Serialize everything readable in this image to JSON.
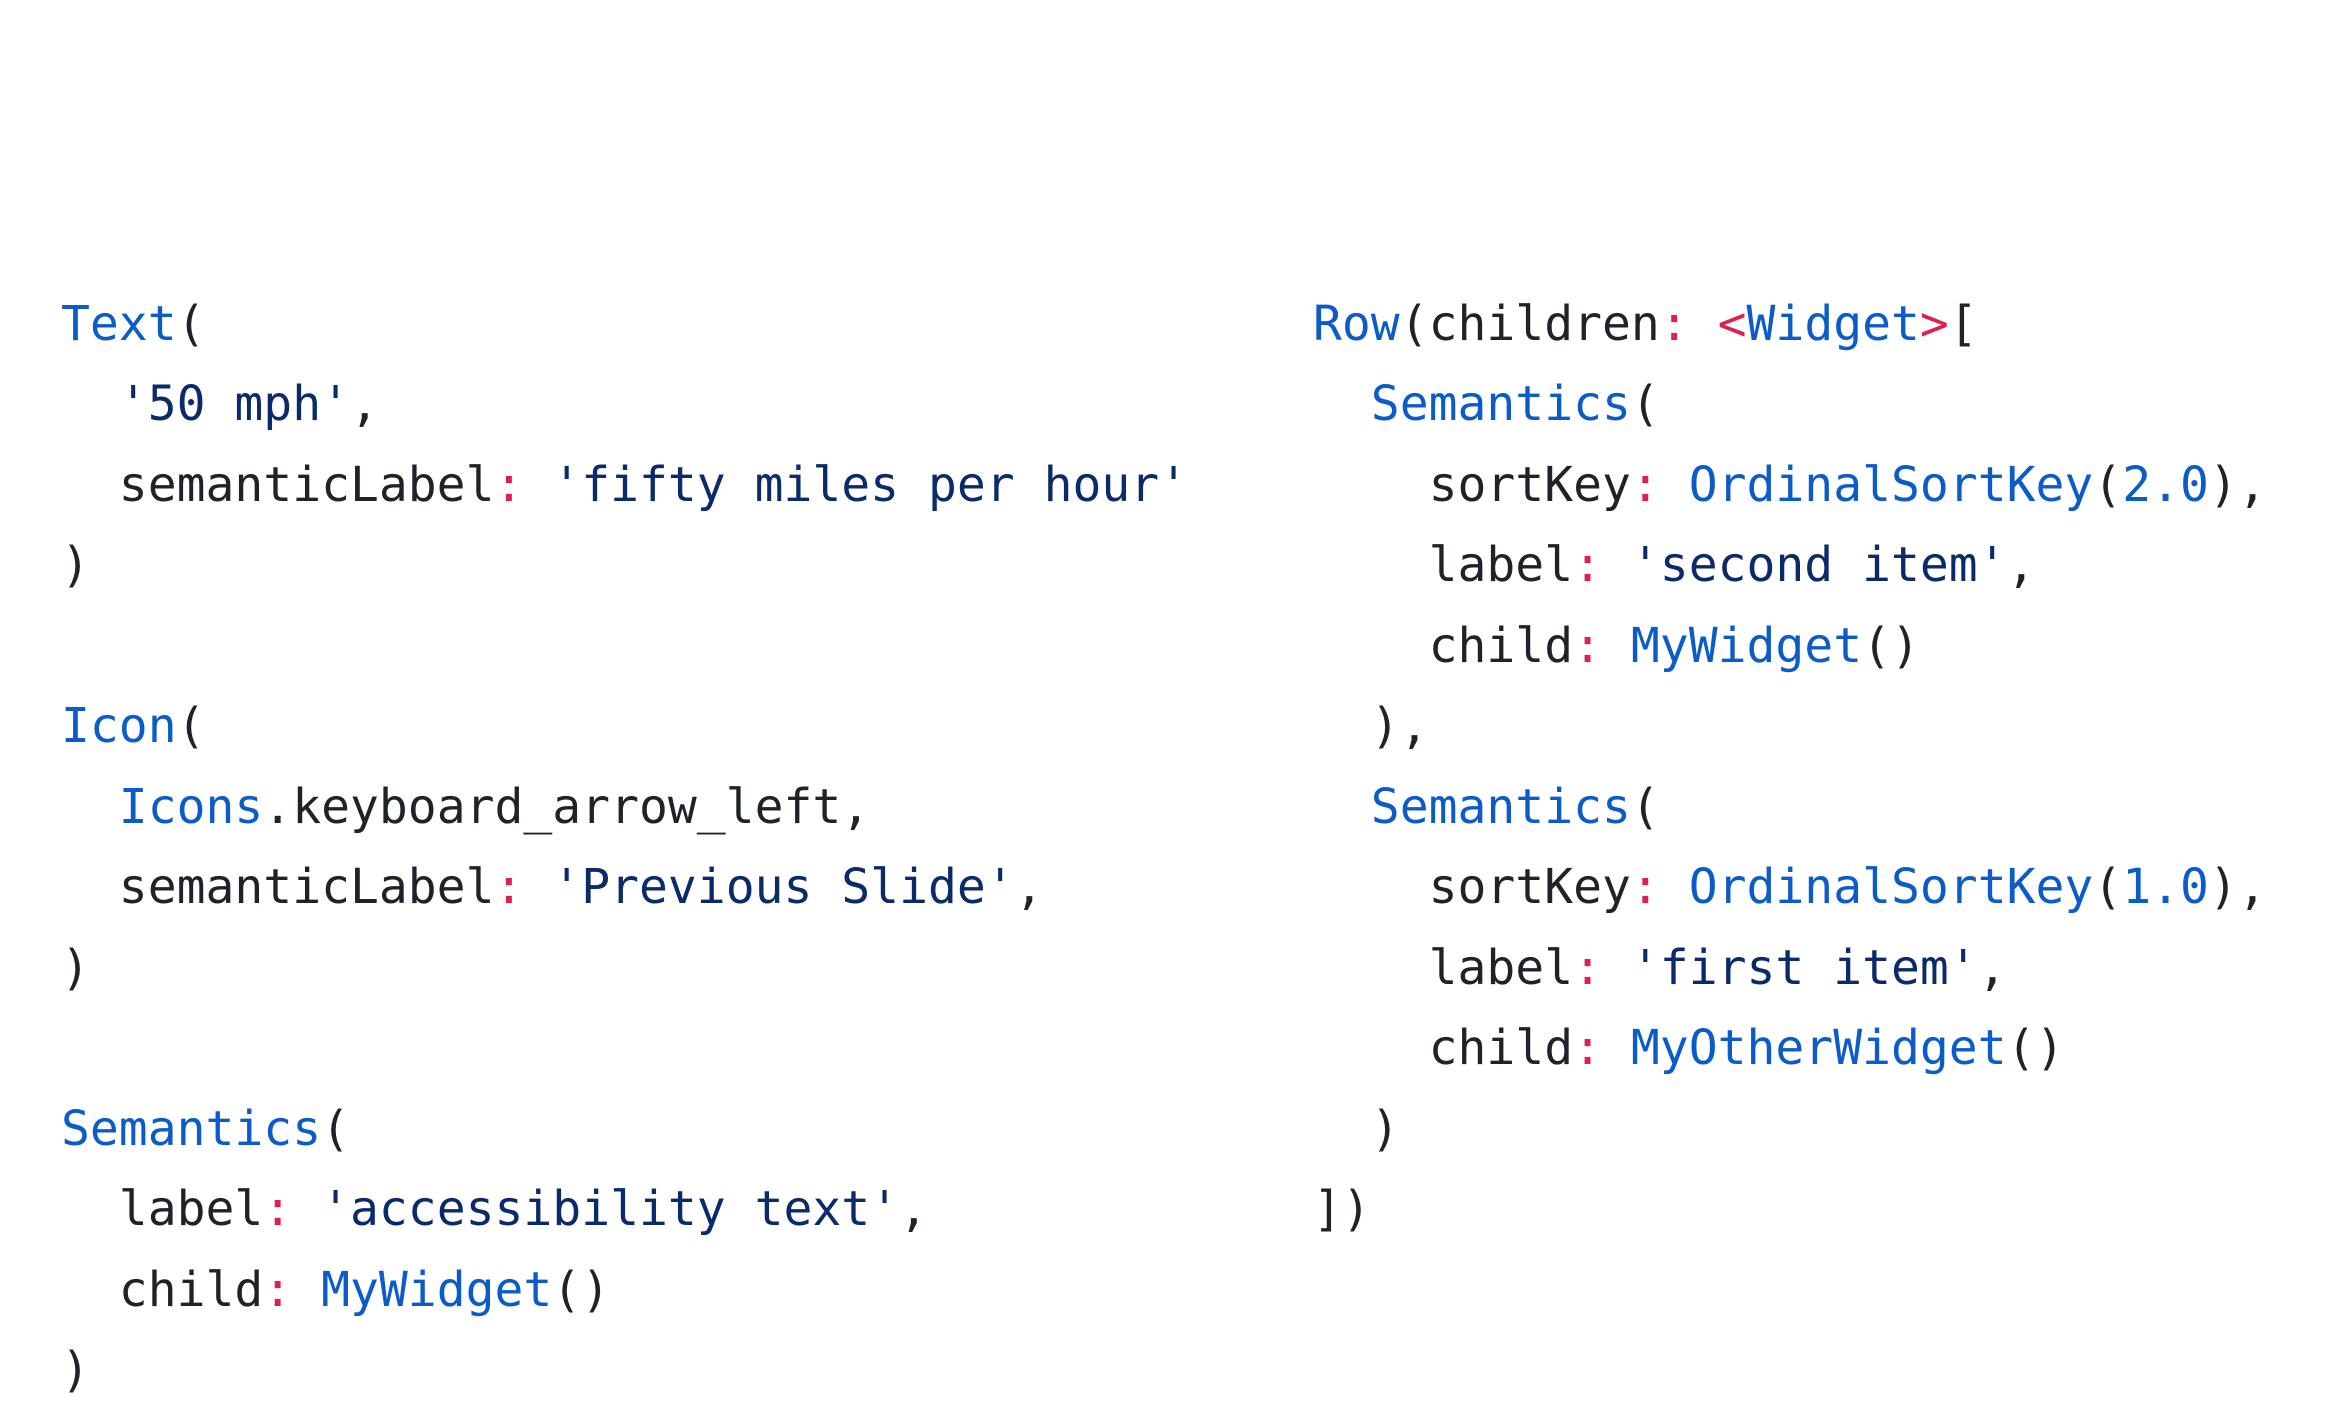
{
  "colors": {
    "type": "#0b5cc9",
    "plain": "#1f2329",
    "colon": "#e01f4c",
    "string": "#0a2a6b",
    "number": "#0b5cc9",
    "generic": "#e01f4c",
    "background": "#ffffff"
  },
  "code": {
    "left_lines": [
      [
        {
          "t": "type",
          "v": "Text"
        },
        {
          "t": "punct",
          "v": "("
        }
      ],
      [
        {
          "t": "plain",
          "v": "  "
        },
        {
          "t": "string",
          "v": "'50 mph'"
        },
        {
          "t": "punct",
          "v": ","
        }
      ],
      [
        {
          "t": "plain",
          "v": "  semanticLabel"
        },
        {
          "t": "colon",
          "v": ":"
        },
        {
          "t": "plain",
          "v": " "
        },
        {
          "t": "string",
          "v": "'fifty miles per hour'"
        }
      ],
      [
        {
          "t": "punct",
          "v": ")"
        }
      ],
      [
        {
          "t": "plain",
          "v": ""
        }
      ],
      [
        {
          "t": "type",
          "v": "Icon"
        },
        {
          "t": "punct",
          "v": "("
        }
      ],
      [
        {
          "t": "plain",
          "v": "  "
        },
        {
          "t": "type",
          "v": "Icons"
        },
        {
          "t": "plain",
          "v": ".keyboard_arrow_left,"
        }
      ],
      [
        {
          "t": "plain",
          "v": "  semanticLabel"
        },
        {
          "t": "colon",
          "v": ":"
        },
        {
          "t": "plain",
          "v": " "
        },
        {
          "t": "string",
          "v": "'Previous Slide'"
        },
        {
          "t": "punct",
          "v": ","
        }
      ],
      [
        {
          "t": "punct",
          "v": ")"
        }
      ],
      [
        {
          "t": "plain",
          "v": ""
        }
      ],
      [
        {
          "t": "type",
          "v": "Semantics"
        },
        {
          "t": "punct",
          "v": "("
        }
      ],
      [
        {
          "t": "plain",
          "v": "  label"
        },
        {
          "t": "colon",
          "v": ":"
        },
        {
          "t": "plain",
          "v": " "
        },
        {
          "t": "string",
          "v": "'accessibility text'"
        },
        {
          "t": "punct",
          "v": ","
        }
      ],
      [
        {
          "t": "plain",
          "v": "  child"
        },
        {
          "t": "colon",
          "v": ":"
        },
        {
          "t": "plain",
          "v": " "
        },
        {
          "t": "type",
          "v": "MyWidget"
        },
        {
          "t": "punct",
          "v": "()"
        }
      ],
      [
        {
          "t": "punct",
          "v": ")"
        }
      ]
    ],
    "right_lines": [
      [
        {
          "t": "type",
          "v": "Row"
        },
        {
          "t": "punct",
          "v": "(children"
        },
        {
          "t": "colon",
          "v": ":"
        },
        {
          "t": "plain",
          "v": " "
        },
        {
          "t": "generic",
          "v": "<"
        },
        {
          "t": "type",
          "v": "Widget"
        },
        {
          "t": "generic",
          "v": ">"
        },
        {
          "t": "punct",
          "v": "["
        }
      ],
      [
        {
          "t": "plain",
          "v": "  "
        },
        {
          "t": "type",
          "v": "Semantics"
        },
        {
          "t": "punct",
          "v": "("
        }
      ],
      [
        {
          "t": "plain",
          "v": "    sortKey"
        },
        {
          "t": "colon",
          "v": ":"
        },
        {
          "t": "plain",
          "v": " "
        },
        {
          "t": "type",
          "v": "OrdinalSortKey"
        },
        {
          "t": "punct",
          "v": "("
        },
        {
          "t": "number",
          "v": "2.0"
        },
        {
          "t": "punct",
          "v": "),"
        }
      ],
      [
        {
          "t": "plain",
          "v": "    label"
        },
        {
          "t": "colon",
          "v": ":"
        },
        {
          "t": "plain",
          "v": " "
        },
        {
          "t": "string",
          "v": "'second item'"
        },
        {
          "t": "punct",
          "v": ","
        }
      ],
      [
        {
          "t": "plain",
          "v": "    child"
        },
        {
          "t": "colon",
          "v": ":"
        },
        {
          "t": "plain",
          "v": " "
        },
        {
          "t": "type",
          "v": "MyWidget"
        },
        {
          "t": "punct",
          "v": "()"
        }
      ],
      [
        {
          "t": "plain",
          "v": "  "
        },
        {
          "t": "punct",
          "v": "),"
        }
      ],
      [
        {
          "t": "plain",
          "v": "  "
        },
        {
          "t": "type",
          "v": "Semantics"
        },
        {
          "t": "punct",
          "v": "("
        }
      ],
      [
        {
          "t": "plain",
          "v": "    sortKey"
        },
        {
          "t": "colon",
          "v": ":"
        },
        {
          "t": "plain",
          "v": " "
        },
        {
          "t": "type",
          "v": "OrdinalSortKey"
        },
        {
          "t": "punct",
          "v": "("
        },
        {
          "t": "number",
          "v": "1.0"
        },
        {
          "t": "punct",
          "v": "),"
        }
      ],
      [
        {
          "t": "plain",
          "v": "    label"
        },
        {
          "t": "colon",
          "v": ":"
        },
        {
          "t": "plain",
          "v": " "
        },
        {
          "t": "string",
          "v": "'first item'"
        },
        {
          "t": "punct",
          "v": ","
        }
      ],
      [
        {
          "t": "plain",
          "v": "    child"
        },
        {
          "t": "colon",
          "v": ":"
        },
        {
          "t": "plain",
          "v": " "
        },
        {
          "t": "type",
          "v": "MyOtherWidget"
        },
        {
          "t": "punct",
          "v": "()"
        }
      ],
      [
        {
          "t": "plain",
          "v": "  "
        },
        {
          "t": "punct",
          "v": ")"
        }
      ],
      [
        {
          "t": "punct",
          "v": "])"
        }
      ]
    ]
  }
}
